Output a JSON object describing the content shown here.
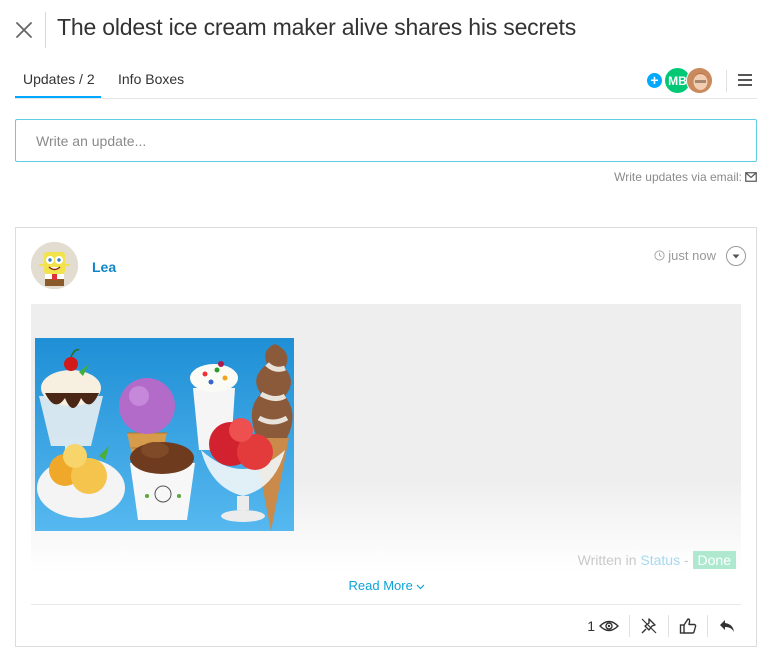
{
  "header": {
    "title": "The oldest ice cream maker alive shares his secrets"
  },
  "tabs": [
    {
      "label": "Updates / 2",
      "active": true
    },
    {
      "label": "Info Boxes",
      "active": false
    }
  ],
  "subscribers": {
    "add_icon": "plus-circle-icon",
    "initials": "MB",
    "initials_color": "#00c875"
  },
  "composer": {
    "placeholder": "Write an update...",
    "email_label": "Write updates via email:",
    "email_icon": "envelope-icon"
  },
  "post": {
    "author": "Lea",
    "time": "just now",
    "written_in_prefix": "Written in",
    "written_in_column": "Status",
    "written_in_separator": "-",
    "status_value": "Done",
    "status_color": "#00c875",
    "read_more": "Read More",
    "views": "1",
    "footer_icons": [
      "eye-icon",
      "pin-icon",
      "thumbs-up-icon",
      "reply-icon"
    ]
  },
  "colors": {
    "accent": "#00a9ff",
    "link": "#0f86c9",
    "input_border": "#5fcde4"
  }
}
